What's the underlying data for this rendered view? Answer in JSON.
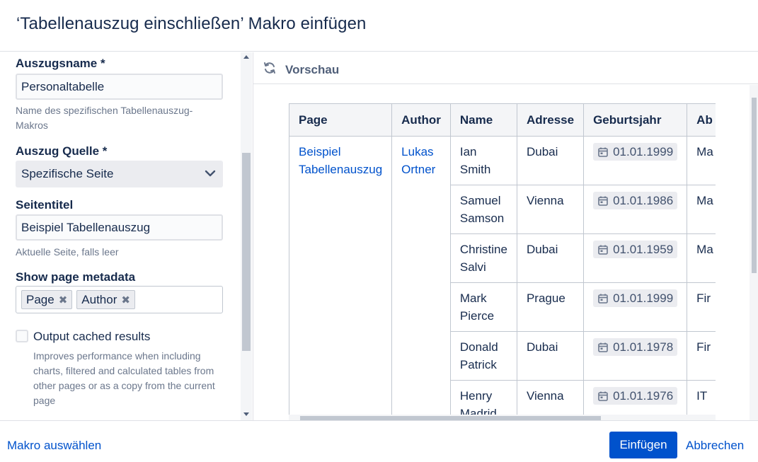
{
  "dialog": {
    "title": "‘Tabellenauszug einschließen’ Makro einfügen"
  },
  "form": {
    "excerpt_name": {
      "label": "Auszugsname *",
      "value": "Personaltabelle",
      "help": "Name des spezifischen Tabellenauszug-Makros"
    },
    "source": {
      "label": "Auszug Quelle *",
      "value": "Spezifische Seite"
    },
    "page_title": {
      "label": "Seitentitel",
      "value": "Beispiel Tabellenauszug",
      "help": "Aktuelle Seite, falls leer"
    },
    "metadata": {
      "label": "Show page metadata",
      "tags": [
        "Page",
        "Author"
      ]
    },
    "cached": {
      "label": "Output cached results",
      "checked": false,
      "help": "Improves performance when including charts, filtered and calculated tables from other pages or as a copy from the current page"
    }
  },
  "preview": {
    "title": "Vorschau",
    "columns": [
      "Page",
      "Author",
      "Name",
      "Adresse",
      "Geburtsjahr",
      "Ab"
    ],
    "page_link": "Beispiel Tabellenauszug",
    "author_link": "Lukas Ortner",
    "rows": [
      {
        "name": "Ian Smith",
        "address": "Dubai",
        "birth": "01.01.1999",
        "dept": "Ma"
      },
      {
        "name": "Samuel Samson",
        "address": "Vienna",
        "birth": "01.01.1986",
        "dept": "Ma"
      },
      {
        "name": "Christine Salvi",
        "address": "Dubai",
        "birth": "01.01.1959",
        "dept": "Ma"
      },
      {
        "name": "Mark Pierce",
        "address": "Prague",
        "birth": "01.01.1999",
        "dept": "Fir"
      },
      {
        "name": "Donald Patrick",
        "address": "Dubai",
        "birth": "01.01.1978",
        "dept": "Fir"
      },
      {
        "name": "Henry Madrid",
        "address": "Vienna",
        "birth": "01.01.1976",
        "dept": "IT"
      }
    ]
  },
  "footer": {
    "select_macro": "Makro auswählen",
    "insert": "Einfügen",
    "cancel": "Abbrechen"
  },
  "colors": {
    "primary": "#0052cc",
    "text": "#172b4d",
    "muted": "#6b778c"
  }
}
